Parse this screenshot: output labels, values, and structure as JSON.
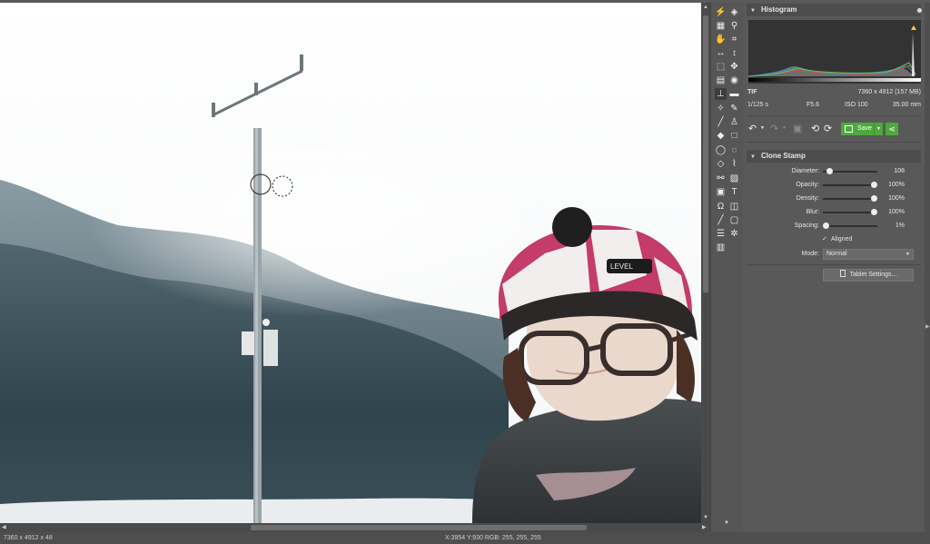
{
  "canvas": {
    "brand_text": "LEVEL"
  },
  "status": {
    "image_info": "7360 x 4912 x 48",
    "cursor_info": "X:3954 Y:930   RGB: 255, 255, 255"
  },
  "tools": [
    "lightning-icon",
    "eraser-3d-icon",
    "grid-icon",
    "zoom-icon",
    "hand-icon",
    "crop-icon",
    "horizontal-measure-icon",
    "vertical-measure-icon",
    "rect-select-icon",
    "transform-icon",
    "gradient-icon",
    "eye-icon",
    "clone-stamp-icon",
    "stamp-alt-icon",
    "magic-wand-icon",
    "pen-icon",
    "brush-icon",
    "bucket-icon",
    "eraser-icon",
    "rect-icon",
    "ellipse-icon",
    "lasso-icon",
    "poly-lasso-icon",
    "brush-select-icon",
    "magnify-select-icon",
    "edit-icon",
    "paste-icon",
    "text-icon",
    "omega-icon",
    "layer-icon",
    "line-icon",
    "frame-icon",
    "lines-icon",
    "settings-icon",
    "layout-icon"
  ],
  "histogram": {
    "title": "Histogram",
    "format": "TIF",
    "dimensions": "7360 x 4912 (157 MB)",
    "shutter": "1/125 s",
    "aperture": "F5.6",
    "iso": "ISO 100",
    "focal": "35.00 mm"
  },
  "actions": {
    "save_label": "Save",
    "colors": {
      "save": "#4caa3c"
    }
  },
  "clone_stamp": {
    "title": "Clone Stamp",
    "settings": [
      {
        "label": "Diameter:",
        "value": "108",
        "level": 0.08
      },
      {
        "label": "Opacity:",
        "value": "100%",
        "level": 1.0
      },
      {
        "label": "Density:",
        "value": "100%",
        "level": 1.0
      },
      {
        "label": "Blur:",
        "value": "100%",
        "level": 1.0
      },
      {
        "label": "Spacing:",
        "value": "1%",
        "level": 0.0
      }
    ],
    "aligned_label": "Aligned",
    "aligned_checked": true,
    "mode_label": "Mode:",
    "mode_value": "Normal",
    "tablet_label": "Tablet Settings..."
  }
}
